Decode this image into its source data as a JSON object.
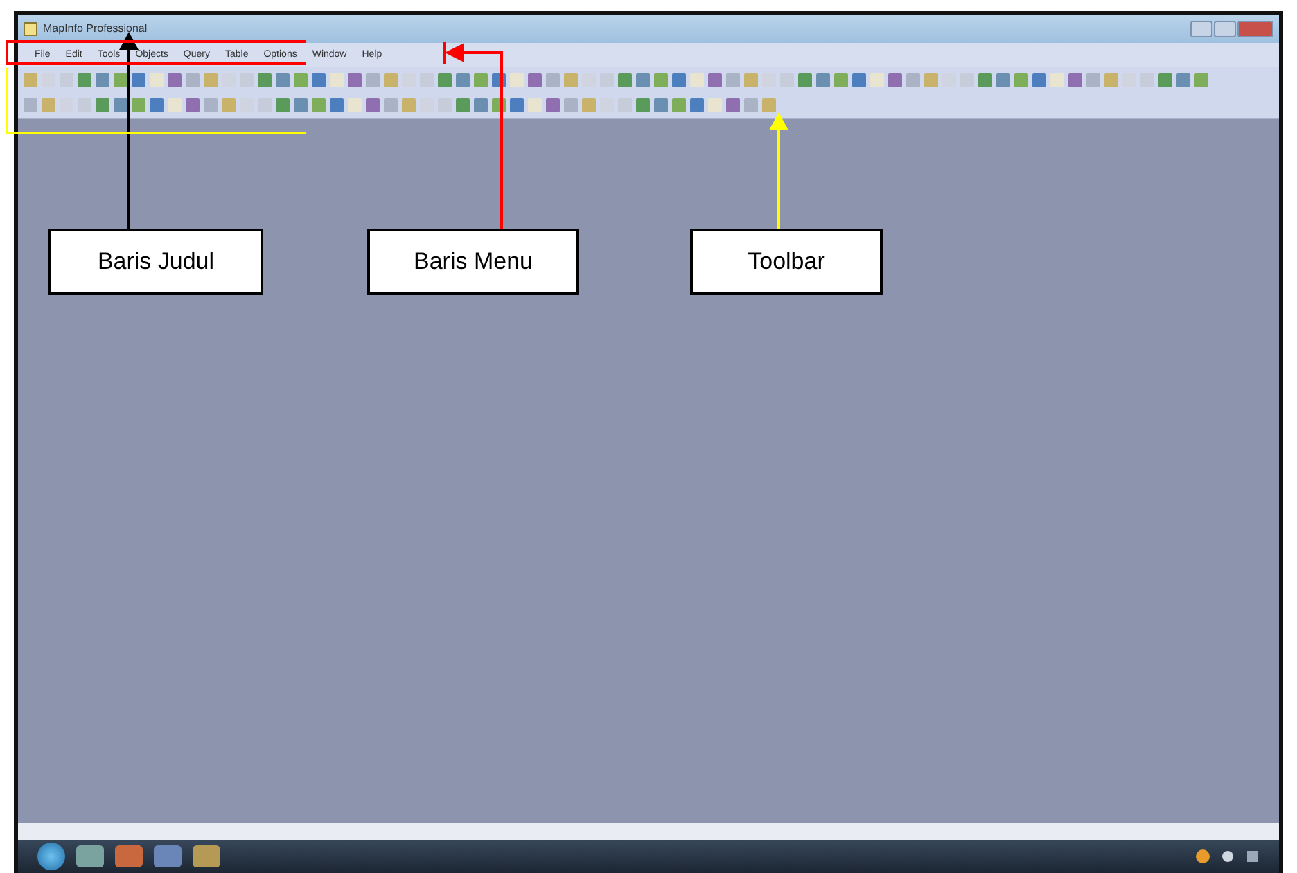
{
  "window": {
    "title": "MapInfo Professional"
  },
  "menu": [
    "File",
    "Edit",
    "Tools",
    "Objects",
    "Query",
    "Table",
    "Options",
    "Window",
    "Help"
  ],
  "annotations": [
    {
      "label": "Baris Judul",
      "color": "#000000"
    },
    {
      "label": "Baris Menu",
      "color": "#ff0000"
    },
    {
      "label": "Toolbar",
      "color": "#ffff00"
    }
  ]
}
